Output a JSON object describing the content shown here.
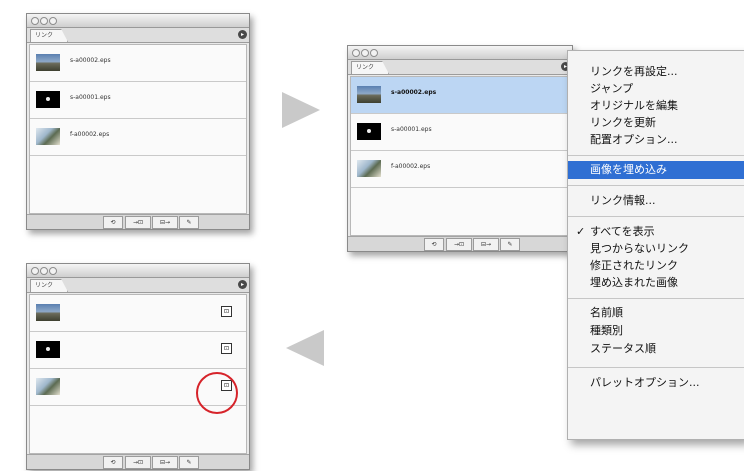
{
  "panel": {
    "tab_label": "リンク",
    "menu_button": "▸"
  },
  "links": [
    {
      "name": "s-a00002.eps"
    },
    {
      "name": "s-a00001.eps"
    },
    {
      "name": "f-a00002.eps"
    }
  ],
  "footer_buttons": [
    "⟲",
    "→⊡",
    "⊟→",
    "✎"
  ],
  "embed_icon_glyph": "⊡",
  "menu": {
    "group1": [
      "リンクを再設定...",
      "ジャンプ",
      "オリジナルを編集",
      "リンクを更新",
      "配置オプション..."
    ],
    "highlighted": "画像を埋め込み",
    "group2": [
      "リンク情報..."
    ],
    "check_mark": "✓",
    "group3": [
      "すべてを表示",
      "見つからないリンク",
      "修正されたリンク",
      "埋め込まれた画像"
    ],
    "group4": [
      "名前順",
      "種類別",
      "ステータス順"
    ],
    "group5": [
      "パレットオプション..."
    ]
  },
  "colors": {
    "highlight": "#2f6fd3",
    "selection": "#bcd6f3",
    "circle": "#d6232a",
    "arrow": "#c9c9c9"
  }
}
